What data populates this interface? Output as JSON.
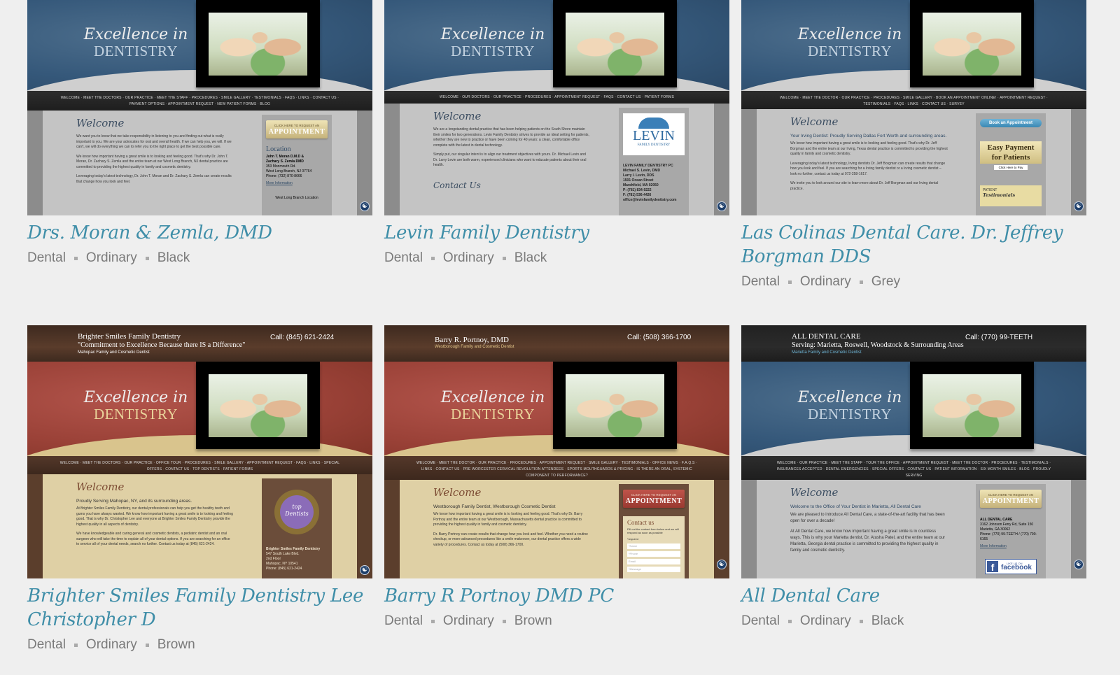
{
  "cards": [
    {
      "title": "Drs. Moran & Zemla, DMD",
      "tags": [
        "Dental",
        "Ordinary",
        "Black"
      ],
      "preview": {
        "slogan_line1": "Excellence in",
        "slogan_line2": "DENTISTRY",
        "nav": "WELCOME · MEET THE DOCTORS · OUR PRACTICE · MEET THE STAFF · PROCEDURES · SMILE GALLERY · TESTIMONIALS · FAQS · LINKS · CONTACT US · PAYMENT OPTIONS · APPOINTMENT REQUEST · NEW PATIENT FORMS · BLOG",
        "welcome": "Welcome",
        "body1": "We want you to know that we take responsibility in listening to you and finding out what is really important to you. We are your advocates for oral and overall health. If we can help you, we will. If we can't, we will do everything we can to refer you to the right place to get the best possible care.",
        "body2": "We know how important having a great smile is to looking and feeling good. That's why Dr. John T. Moran, Dr. Zachary S. Zemla and the entire team at our West Long Branch, NJ dental practice are committed to providing the highest quality in family and cosmetic dentistry.",
        "body3": "Leveraging today's latest technology, Dr. John T. Moran and Dr. Zachary S. Zemla can create results that change how you look and feel.",
        "appt_small": "CLICK HERE TO REQUEST AN",
        "appt_big": "APPOINTMENT",
        "side_heading": "Location",
        "side_lines": [
          "John T. Moran D.M.D &",
          "Zachary S. Zemla DMD",
          "353 Monmouth Rd.",
          "West Long Branch, NJ 07764",
          "Phone: (732) 870-8666",
          "More Information",
          "West Long Branch Location"
        ]
      }
    },
    {
      "title": "Levin Family Dentistry",
      "tags": [
        "Dental",
        "Ordinary",
        "Black"
      ],
      "preview": {
        "slogan_line1": "Excellence in",
        "slogan_line2": "DENTISTRY",
        "nav": "WELCOME · OUR DOCTORS · OUR PRACTICE · PROCEDURES · APPOINTMENT REQUEST · FAQS · CONTACT US · PATIENT FORMS",
        "welcome": "Welcome",
        "body1": "We are a longstanding dental practice that has been helping patients on the South Shore maintain their smiles for two generations. Levin Family Dentistry strives to provide an ideal setting for patients, whether they are new to practice or have been coming for 40 years: a clean, comfortable office complete with the latest in dental technology.",
        "body2": "Simply put, our singular intent is to align our treatment objectives with yours. Dr. Michael Levin and Dr. Larry Levin are both warm, experienced clinicians who want to educate patients about their oral health.",
        "contact_heading": "Contact Us",
        "logo_big": "LEVIN",
        "logo_small": "FAMILY DENTISTRY",
        "side_lines": [
          "LEVIN FAMILY DENTISTRY PC",
          "Michael S. Levin, DMD",
          "Larry I. Levin, DDS",
          "1501 Ocean Street",
          "Marshfield, MA 02050",
          "P: (781) 834-9222",
          "F: (781) 536-4426",
          "office@levinfamilydentistry.com"
        ]
      }
    },
    {
      "title": "Las Colinas Dental Care. Dr. Jeffrey Borgman DDS",
      "tags": [
        "Dental",
        "Ordinary",
        "Grey"
      ],
      "preview": {
        "slogan_line1": "Excellence in",
        "slogan_line2": "DENTISTRY",
        "nav": "WELCOME · MEET THE DOCTOR · OUR PRACTICE · PROCEDURES · SMILE GALLERY · BOOK AN APPOINTMENT ONLINE! · APPOINTMENT REQUEST · TESTIMONIALS · FAQS · LINKS · CONTACT US · SURVEY",
        "welcome": "Welcome",
        "lead": "Your Irving Dentist: Proudly Serving Dallas Fort Worth and surrounding areas.",
        "body1": "We know how important having a great smile is to looking and feeling good. That's why Dr. Jeff Borgman and the entire team at our Irving, Texas dental practice is committed to providing the highest quality in family and cosmetic dentistry.",
        "body2": "Leveraging today's latest technology, Irving dentists Dr. Jeff Borgman can create results that change how you look and feel. If you are searching for a Irving family dentist or a Irving cosmetic dentist – look no further, contact us today at 972-258-1617.",
        "body3": "We invite you to look around our site to learn more about Dr. Jeff Borgman and our Irving dental practice.",
        "book_btn": "Book an Appointment",
        "pay_line1": "Easy Payment",
        "pay_line2": "for Patients",
        "pay_btn": "Click Here to Pay",
        "testimonials_small": "PATIENT",
        "testimonials_big": "Testimonials"
      }
    },
    {
      "title": "Brighter Smiles Family Dentistry Lee Christopher D",
      "tags": [
        "Dental",
        "Ordinary",
        "Brown"
      ],
      "preview": {
        "site_name": "Brighter Smiles Family Dentistry",
        "site_tagline": "\"Commitment to Excellence Because there IS a Difference\"",
        "site_sub": "Mahopac Family and Cosmetic Dentist",
        "call": "Call: (845) 621-2424",
        "slogan_line1": "Excellence in",
        "slogan_line2": "DENTISTRY",
        "nav": "WELCOME · MEET THE DOCTORS · OUR PRACTICE · OFFICE TOUR · PROCEDURES · SMILE GALLERY · APPOINTMENT REQUEST · FAQS · LINKS · SPECIAL OFFERS · CONTACT US · TOP DENTISTS · PATIENT FORMS",
        "welcome": "Welcome",
        "lead": "Proudly Serving Mahopac, NY, and its surrounding areas.",
        "body1": "At Brighter Smiles Family Dentistry, our dental professionals can help you get the healthy teeth and gums you have always wanted. We know how important having a great smile is to looking and feeling good. That is why Dr. Christopher Lee and everyone at Brighter Smiles Family Dentistry provide the highest quality in all aspects of dentistry.",
        "body2": "We have knowledgeable and caring general and cosmetic dentists, a pediatric dentist and an oral surgeon who will take the time to explain all of your dental options. If you are searching for an office to service all of your dental needs, search no further. Contact us today at (845) 621-2424.",
        "badge_top": "top",
        "badge_bottom": "Dentists",
        "side_lines": [
          "Brighter Smiles Family Dentistry",
          "547 South Lake Blvd.",
          "2nd Floor",
          "Mahopac, NY 10541",
          "Phone: (845) 621-2424"
        ]
      }
    },
    {
      "title": "Barry R Portnoy DMD PC",
      "tags": [
        "Dental",
        "Ordinary",
        "Brown"
      ],
      "preview": {
        "site_name": "Barry R. Portnoy, DMD",
        "site_sub": "Westborough Family and Cosmetic Dentist",
        "call": "Call: (508) 366-1700",
        "slogan_line1": "Excellence in",
        "slogan_line2": "DENTISTRY",
        "nav": "WELCOME · MEET THE DOCTOR · OUR PRACTICE · PROCEDURES · APPOINTMENT REQUEST · SMILE GALLERY · TESTIMONIALS · OFFICE NEWS · F.A.Q.S · LINKS · CONTACT US · PRE WORCESTER CERVICAL REVOLUTION ATTENDEES · SPORTS MOUTHGUARDS & PRICING · IS THERE AN ORAL, SYSTEMIC COMPONENT TO PERFORMANCE?",
        "welcome": "Welcome",
        "lead": "Westborough Family Dentist, Westborough Cosmetic Dentist",
        "body1": "We know how important having a great smile is to looking and feeling good. That's why Dr. Barry Portnoy and the entire team at our Westborough, Massachusetts dental practice is committed to providing the highest quality in family and cosmetic dentistry.",
        "body2": "Dr. Barry Portnoy can create results that change how you look and feel. Whether you need a routine checkup, or more advanced procedures like a smile makeover, our dental practice offers a wide variety of procedures. Contact us today at (508) 366-1700.",
        "appt_small": "CLICK HERE TO REQUEST AN",
        "appt_big": "APPOINTMENT",
        "contact_heading": "Contact us",
        "contact_note": "Fill out the contact form below and we will respond as soon as possible",
        "required": "*required",
        "fields": [
          "*Name",
          "*Phone",
          "Email",
          "*Message"
        ]
      }
    },
    {
      "title": "All Dental Care",
      "tags": [
        "Dental",
        "Ordinary",
        "Black"
      ],
      "preview": {
        "site_name": "ALL DENTAL CARE",
        "site_tagline": "Serving: Marietta, Roswell, Woodstock & Surrounding Areas",
        "site_sub": "Marietta Family and Cosmetic Dentist",
        "call": "Call: (770) 99-TEETH",
        "slogan_line1": "Excellence in",
        "slogan_line2": "DENTISTRY",
        "nav": "WELCOME · OUR PRACTICE · MEET THE STAFF · TOUR THE OFFICE · APPOINTMENT REQUEST · MEET THE DOCTOR · PROCEDURES · TESTIMONIALS · INSURANCES ACCEPTED · DENTAL EMERGENCIES · SPECIAL OFFERS · CONTACT US · PATIENT INFORMATION · SIX MONTH SMILES · BLOG · PROUDLY SERVING",
        "welcome": "Welcome",
        "lead": "Welcome to the Office of Your Dentist in Marietta, All Dental Care",
        "body1": "We are pleased to introduce All Dental Care, a state-of-the-art facility that has been open for over a decade!",
        "body2": "At All Dental Care, we know how important having a great smile is in countless ways. This is why your Marietta dentist, Dr. Atusha Patel, and the entire team at our Marietta, Georgia dental practice is committed to providing the highest quality in family and cosmetic dentistry.",
        "appt_small": "CLICK HERE TO REQUEST AN",
        "appt_big": "APPOINTMENT",
        "side_lines": [
          "ALL DENTAL CARE",
          "3162 Johnson Ferry Rd, Suite 150",
          "Marietta, GA 30062",
          "Phone: (770) 99-TEETH / (770) 790-6165",
          "More Information"
        ],
        "fb_small": "LIKE US ON",
        "fb_big": "facebook"
      }
    }
  ]
}
